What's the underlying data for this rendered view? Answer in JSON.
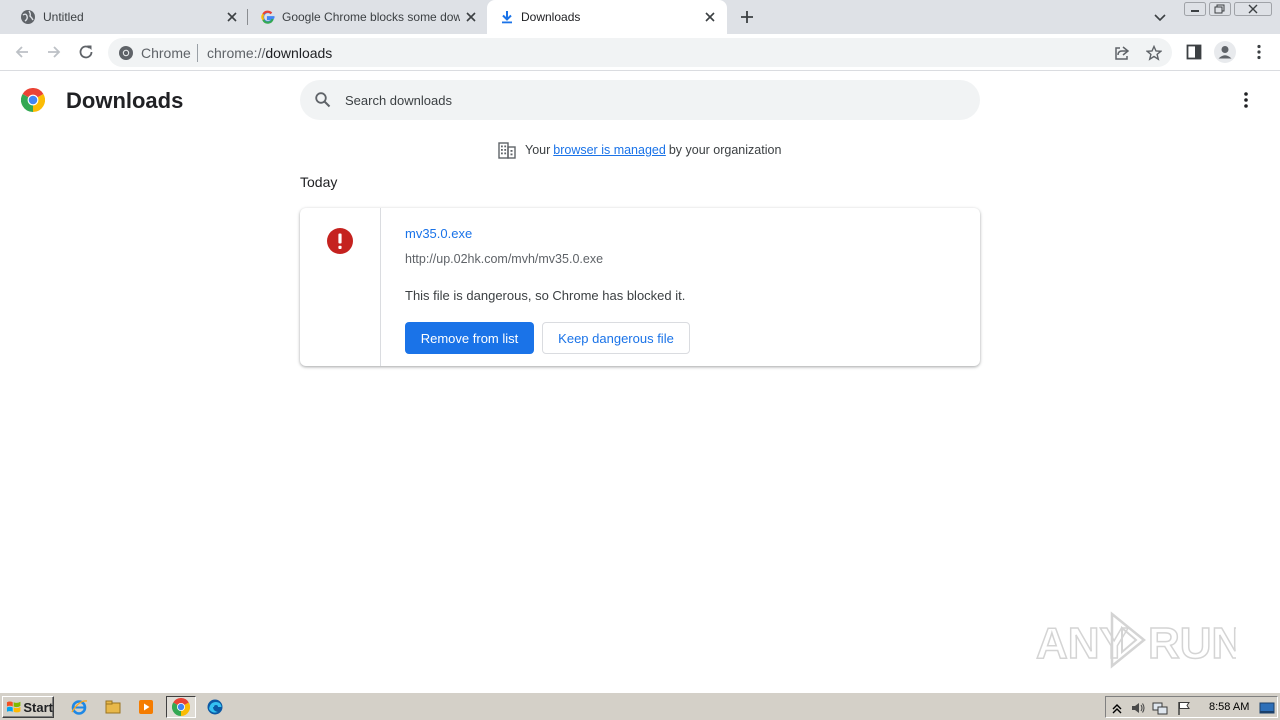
{
  "tabs": [
    {
      "title": "Untitled",
      "active": false
    },
    {
      "title": "Google Chrome blocks some downloa",
      "active": false
    },
    {
      "title": "Downloads",
      "active": true
    }
  ],
  "omnibox": {
    "chip_label": "Chrome",
    "url_scheme": "chrome://",
    "url_path": "downloads"
  },
  "page": {
    "title": "Downloads",
    "search_placeholder": "Search downloads",
    "managed": {
      "prefix": "Your",
      "link": "browser is managed",
      "suffix": "by your organization"
    },
    "section_date": "Today",
    "download": {
      "filename": "mv35.0.exe",
      "url": "http://up.02hk.com/mvh/mv35.0.exe",
      "status": "This file is dangerous, so Chrome has blocked it.",
      "primary_button": "Remove from list",
      "secondary_button": "Keep dangerous file"
    }
  },
  "watermark": "ANY RUN",
  "taskbar": {
    "start_label": "Start",
    "apps": [
      "ie-icon",
      "explorer-icon",
      "media-player-icon",
      "chrome-icon",
      "edge-icon"
    ],
    "clock": "8:58 AM"
  },
  "colors": {
    "accent": "#1a73e8",
    "danger": "#c5221f",
    "tabstrip": "#dee1e6",
    "taskbar": "#d4d0c8"
  }
}
